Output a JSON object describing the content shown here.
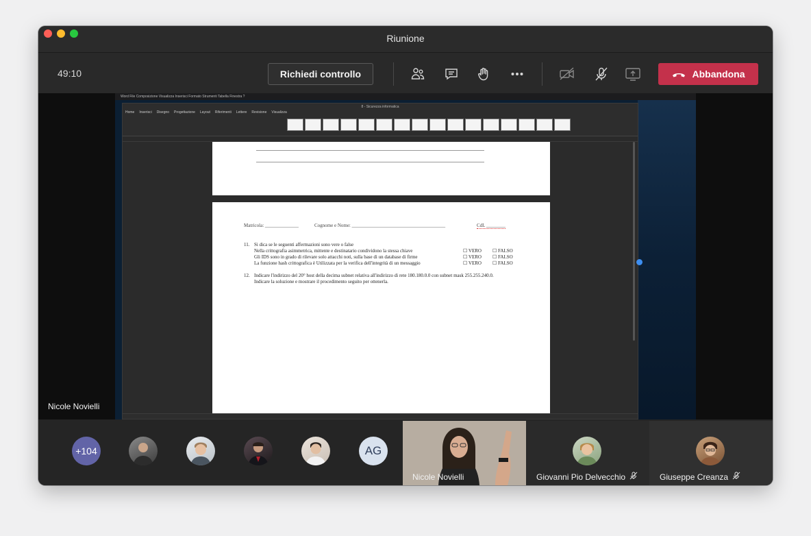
{
  "window": {
    "title": "Riunione"
  },
  "toolbar": {
    "timer": "49:10",
    "request_control": "Richiedi controllo",
    "leave": "Abbandona",
    "icons": [
      "participants-icon",
      "chat-icon",
      "raise-hand-icon",
      "more-icon",
      "camera-off-icon",
      "mic-off-icon",
      "share-screen-icon"
    ]
  },
  "colors": {
    "leave": "#c4314b",
    "count_avatar": "#6264a7"
  },
  "shared_screen": {
    "presenter": "Nicole Novielli",
    "mac_menu": "Word  File  Composizione  Visualizza  Inserisci  Formato  Strumenti  Tabella  Finestra  ?",
    "word_title": "8 - Sicurezza informatica",
    "word_tabs": [
      "Home",
      "Inserisci",
      "Disegno",
      "Progettazione",
      "Layout",
      "Riferimenti",
      "Lettere",
      "Revisione",
      "Visualizza"
    ],
    "document": {
      "header": {
        "matricola": "Matricola: ______________",
        "cognome": "Cognome e Nome: _______________________________________",
        "cdl": "CdL ________"
      },
      "q11": {
        "number": "11.",
        "prompt": "Si dica se le seguenti affermazioni sono vere o false",
        "items": [
          "Nella crittografia asimmetrica, mittente e destinatario condividono la stessa chiave",
          "Gli IDS sono in grado di rilevare solo attacchi noti, sulla base di un database di firme",
          "La funzione hash crittografica è Utilizzata per la verifica dell'integrità di un messaggio"
        ],
        "true_label": "☐ VERO",
        "false_label": "☐ FALSO"
      },
      "q12": {
        "number": "12.",
        "line1": "Indicare l'indirizzo del 20° host della decima subnet relativa all'indirizzo di rete 180.180.0.0 con subnet mask 255.255.240.0.",
        "line2": "Indicare la soluzione e mostrare il procedimento seguito per ottenerla."
      }
    }
  },
  "participants": {
    "count_badge": "+104",
    "initials": "AG",
    "named": [
      {
        "name": "Nicole Novielli"
      },
      {
        "name": "Giovanni Pio Delvecchio"
      },
      {
        "name": "Giuseppe Creanza"
      }
    ]
  }
}
